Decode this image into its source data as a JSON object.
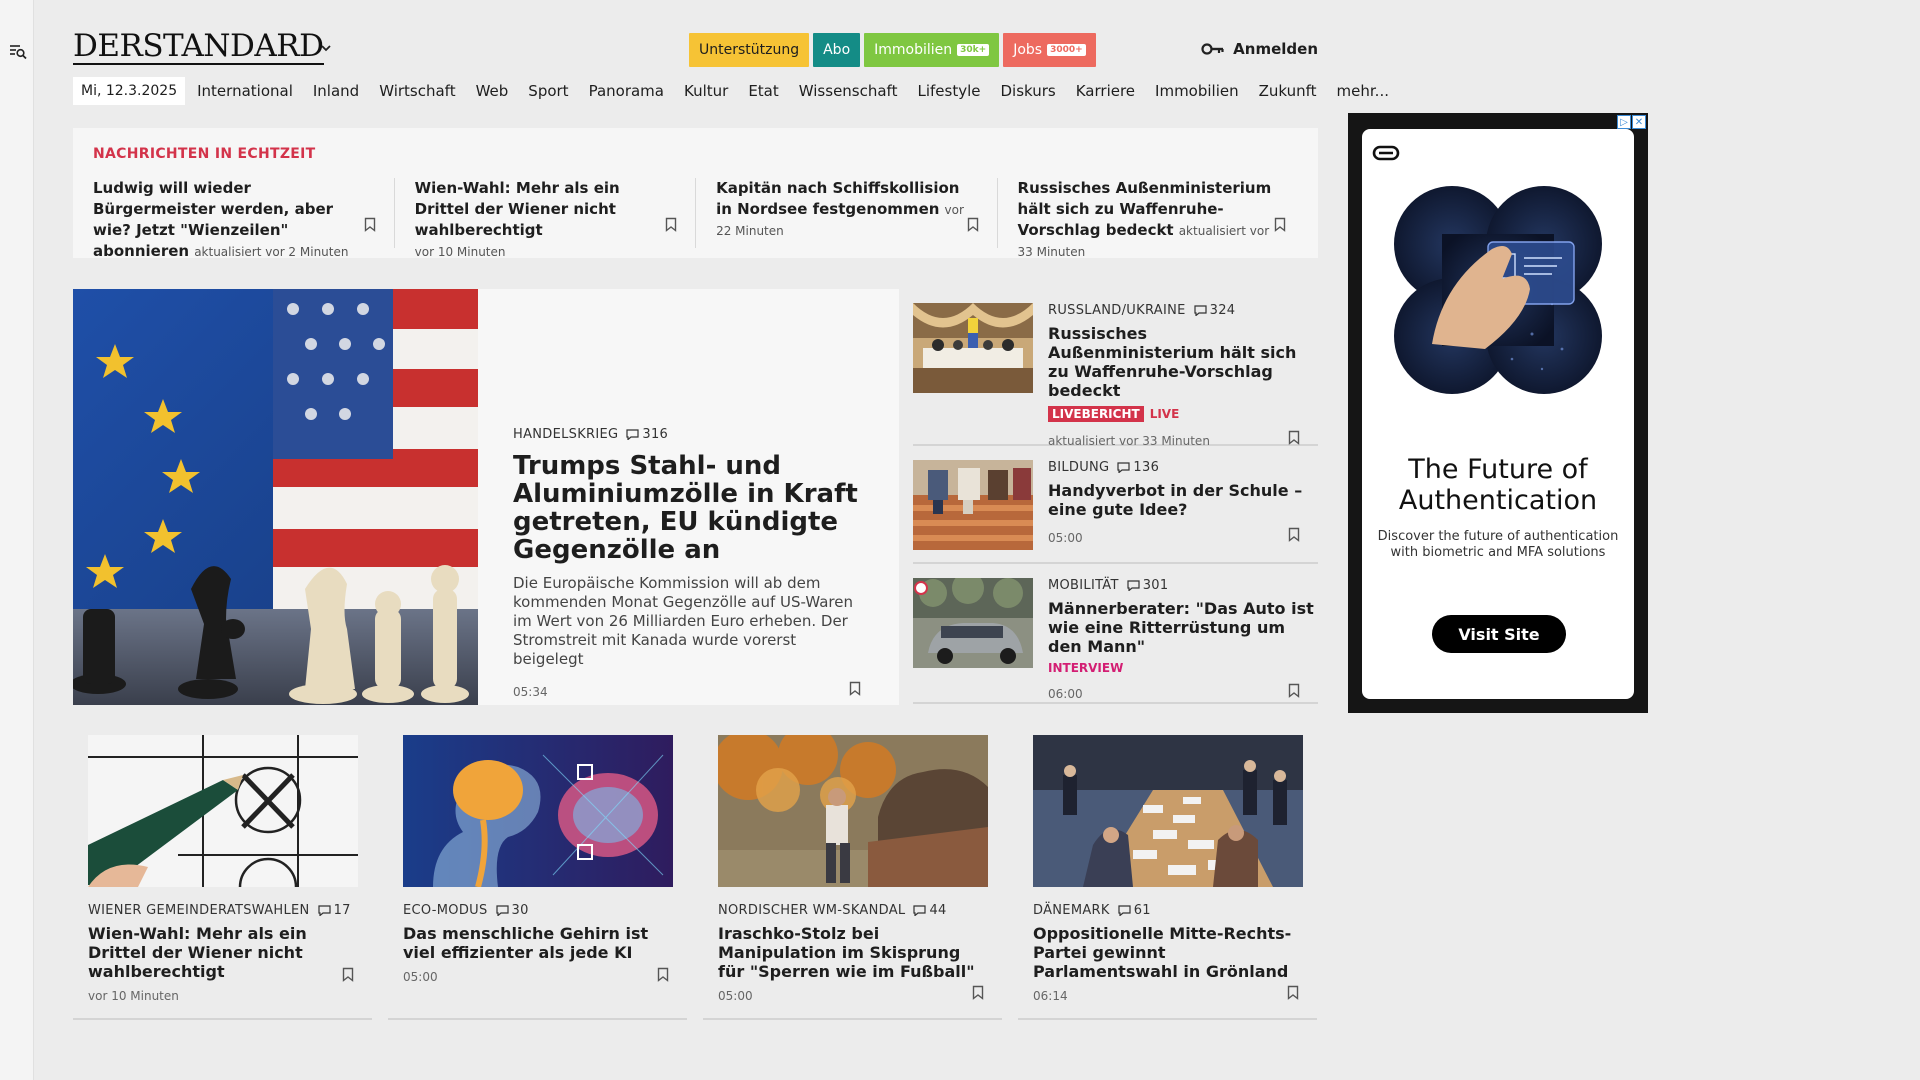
{
  "brand": {
    "logo": "DERSTANDARD"
  },
  "header": {
    "support": "Unterstützung",
    "abo": "Abo",
    "immobilien": "Immobilien",
    "immobilien_badge": "30k+",
    "jobs": "Jobs",
    "jobs_badge": "3000+",
    "login": "Anmelden"
  },
  "nav": {
    "date": "Mi, 12.3.2025",
    "items": [
      "International",
      "Inland",
      "Wirtschaft",
      "Web",
      "Sport",
      "Panorama",
      "Kultur",
      "Etat",
      "Wissenschaft",
      "Lifestyle",
      "Diskurs",
      "Karriere",
      "Immobilien",
      "Zukunft",
      "mehr..."
    ]
  },
  "ticker": {
    "title": "NACHRICHTEN IN ECHTZEIT",
    "items": [
      {
        "title": "Ludwig will wieder Bürgermeister werden, aber wie? Jetzt \"Wienzeilen\" abonnieren",
        "time": "aktualisiert vor 2 Minuten"
      },
      {
        "title": "Wien-Wahl: Mehr als ein Drittel der Wiener nicht wahlberechtigt",
        "time": "vor 10 Minuten"
      },
      {
        "title": "Kapitän nach Schiffskollision in Nordsee festgenommen",
        "time": "vor 22 Minuten"
      },
      {
        "title": "Russisches Außenministerium hält sich zu Waffenruhe-Vorschlag bedeckt",
        "time": "aktualisiert vor 33 Minuten"
      }
    ]
  },
  "hero": {
    "kicker": "HANDELSKRIEG",
    "comments": "316",
    "title": "Trumps Stahl- und Aluminiumzölle in Kraft getreten, EU kündigte Gegenzölle an",
    "lead": "Die Europäische Kommission will ab dem kommenden Monat Gegenzölle auf US-Waren im Wert von 26 Milliarden Euro erheben. Der Stromstreit mit Kanada wurde vorerst beigelegt",
    "time": "05:34"
  },
  "side": [
    {
      "kicker": "RUSSLAND/UKRAINE",
      "comments": "324",
      "title": "Russisches Außenministerium hält sich zu Waffenruhe-Vorschlag bedeckt",
      "tag": "LIVEBERICHT",
      "tag2": "LIVE",
      "time": "aktualisiert vor 33 Minuten"
    },
    {
      "kicker": "BILDUNG",
      "comments": "136",
      "title": "Handyverbot in der Schule – eine gute Idee?",
      "time": "05:00"
    },
    {
      "kicker": "MOBILITÄT",
      "comments": "301",
      "title": "Männerberater: \"Das Auto ist wie eine Ritterrüstung um den Mann\"",
      "tag": "INTERVIEW",
      "time": "06:00"
    }
  ],
  "cards": [
    {
      "kicker": "WIENER GEMEINDERATSWAHLEN",
      "comments": "17",
      "title": "Wien-Wahl: Mehr als ein Drittel der Wiener nicht wahlberechtigt",
      "time": "vor 10 Minuten"
    },
    {
      "kicker": "ECO-MODUS",
      "comments": "30",
      "title": "Das menschliche Gehirn ist viel effizienter als jede KI",
      "time": "05:00"
    },
    {
      "kicker": "NORDISCHER WM-SKANDAL",
      "comments": "44",
      "title": "Iraschko-Stolz bei Manipulation im Skisprung für \"Sperren wie im Fußball\"",
      "time": "05:00"
    },
    {
      "kicker": "DÄNEMARK",
      "comments": "61",
      "title": "Oppositionelle Mitte-Rechts-Partei gewinnt Parlamentswahl in Grönland",
      "time": "06:14"
    }
  ],
  "ad": {
    "headline": "The Future of Authentication",
    "sub": "Discover the future of authentication with biometric and MFA solutions",
    "button": "Visit Site"
  }
}
